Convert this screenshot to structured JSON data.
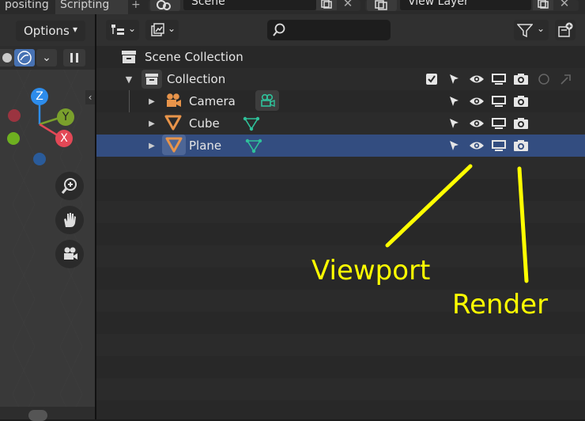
{
  "topbar": {
    "tabs": [
      {
        "label": "positing"
      },
      {
        "label": "Scripting"
      },
      {
        "label": "+"
      }
    ],
    "scene_label": "Scene",
    "view_layer_label": "View Layer"
  },
  "viewport": {
    "options_label": "Options",
    "gizmo": {
      "z": "Z",
      "y": "Y",
      "x": "X"
    },
    "colors": {
      "x": "#e34856",
      "y": "#7aa02c",
      "z": "#2d8ceb"
    }
  },
  "outliner": {
    "search": {
      "placeholder": ""
    },
    "scene_collection": "Scene Collection",
    "collection": "Collection",
    "objects": [
      {
        "name": "Camera",
        "icon": "camera-object-icon",
        "data_icon": "camera-data-icon"
      },
      {
        "name": "Cube",
        "icon": "mesh-object-icon",
        "data_icon": "mesh-data-icon"
      },
      {
        "name": "Plane",
        "icon": "mesh-object-icon",
        "data_icon": "mesh-data-icon",
        "selected": true
      }
    ],
    "selection_color": "#334d80"
  },
  "annotations": {
    "viewport": "Viewport",
    "render": "Render",
    "color": "#ffff00"
  }
}
